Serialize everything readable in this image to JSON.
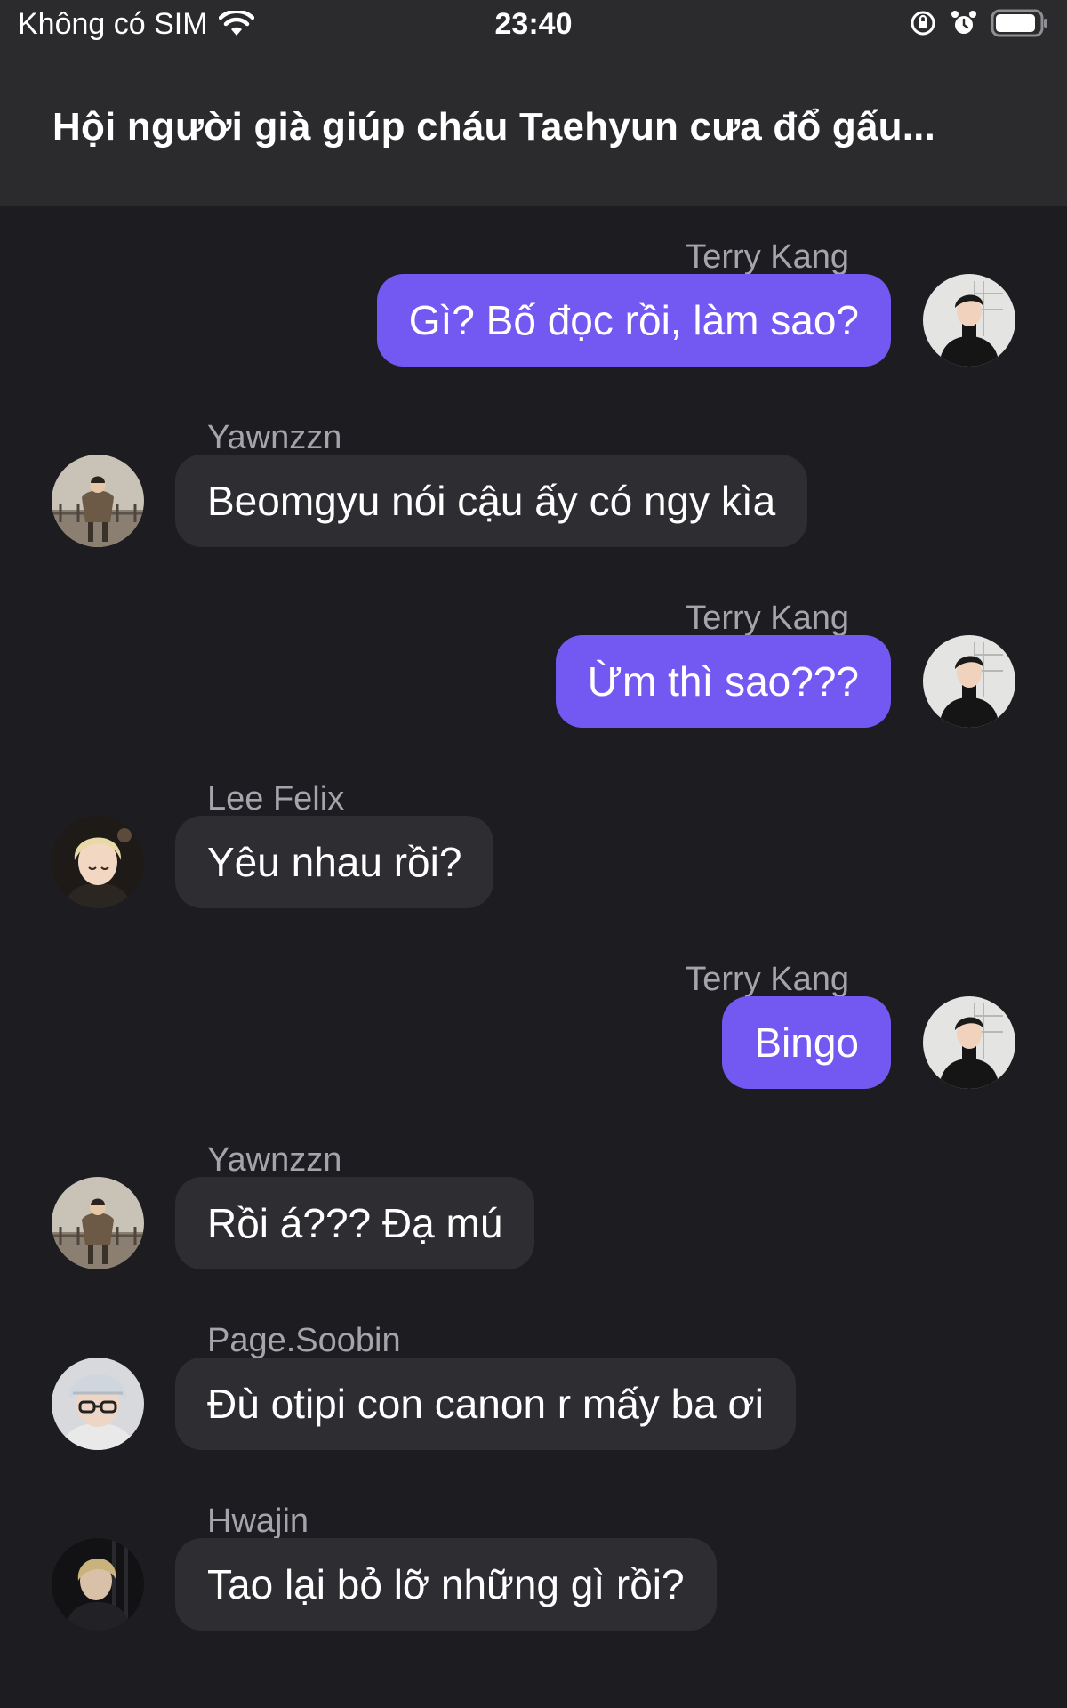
{
  "status_bar": {
    "carrier": "Không có SIM",
    "time": "23:40",
    "icons": [
      "wifi-icon",
      "orientation-lock-icon",
      "alarm-icon",
      "battery-icon"
    ]
  },
  "header": {
    "title": "Hội người già giúp cháu Taehyun cưa đổ gấu..."
  },
  "colors": {
    "background": "#1c1c21",
    "header": "#2b2b2e",
    "incoming_bubble": "#2d2d32",
    "outgoing_bubble": "#7359f2",
    "sender_text": "#a4a4aa"
  },
  "messages": [
    {
      "sender": "Terry Kang",
      "text": "Gì? Bố đọc rồi, làm sao?",
      "direction": "outgoing",
      "avatar": "terry-kang-avatar"
    },
    {
      "sender": "Yawnzzn",
      "text": "Beomgyu nói cậu ấy có ngy kìa",
      "direction": "incoming",
      "avatar": "yawnzzn-avatar"
    },
    {
      "sender": "Terry Kang",
      "text": "Ừm thì sao???",
      "direction": "outgoing",
      "avatar": "terry-kang-avatar"
    },
    {
      "sender": "Lee Felix",
      "text": "Yêu nhau rồi?",
      "direction": "incoming",
      "avatar": "lee-felix-avatar"
    },
    {
      "sender": "Terry Kang",
      "text": "Bingo",
      "direction": "outgoing",
      "avatar": "terry-kang-avatar"
    },
    {
      "sender": "Yawnzzn",
      "text": "Rồi á??? Đạ mú",
      "direction": "incoming",
      "avatar": "yawnzzn-avatar"
    },
    {
      "sender": "Page.Soobin",
      "text": "Đù otipi con canon r mấy ba ơi",
      "direction": "incoming",
      "avatar": "page-soobin-avatar"
    },
    {
      "sender": "Hwajin",
      "text": "Tao lại bỏ lỡ những gì rồi?",
      "direction": "incoming",
      "avatar": "hwajin-avatar"
    }
  ]
}
